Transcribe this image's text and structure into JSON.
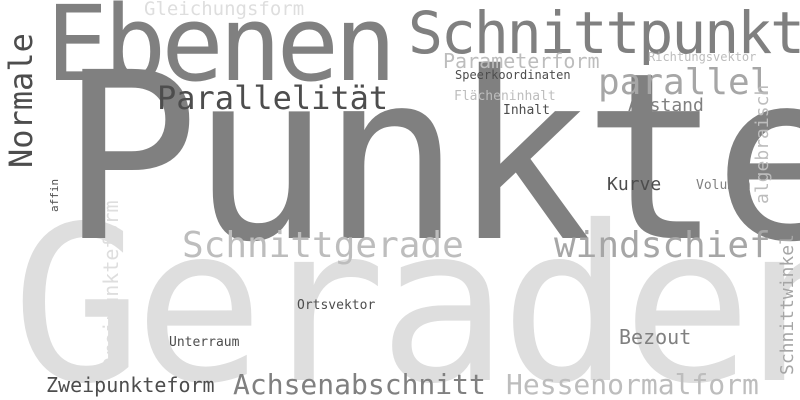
{
  "words": [
    {
      "id": "gerade",
      "text": "Geraden",
      "color": "#dedede"
    },
    {
      "id": "punkte",
      "text": "Punkte",
      "color": "#808080"
    },
    {
      "id": "ebenen",
      "text": "Ebenen",
      "color": "#808080"
    },
    {
      "id": "schnittpunkt",
      "text": "Schnittpunkt",
      "color": "#808080"
    },
    {
      "id": "gleichungsform",
      "text": "Gleichungsform",
      "color": "#dedede"
    },
    {
      "id": "parameterform",
      "text": "Parameterform",
      "color": "#bdbdbd"
    },
    {
      "id": "richtungsvektor",
      "text": "Richtungsvektor",
      "color": "#bdbdbd"
    },
    {
      "id": "speerkoordinaten",
      "text": "Speerkoordinaten",
      "color": "#4d4d4d"
    },
    {
      "id": "parallel",
      "text": "parallel",
      "color": "#a6a6a6"
    },
    {
      "id": "parallelitaet",
      "text": "Parallelität",
      "color": "#4d4d4d"
    },
    {
      "id": "flaecheninhalt",
      "text": "Flächeninhalt",
      "color": "#bdbdbd"
    },
    {
      "id": "abstand",
      "text": "Abstand",
      "color": "#808080"
    },
    {
      "id": "inhalt",
      "text": "Inhalt",
      "color": "#4d4d4d"
    },
    {
      "id": "normale",
      "text": "Normale",
      "color": "#4d4d4d"
    },
    {
      "id": "affin",
      "text": "affin",
      "color": "#4d4d4d"
    },
    {
      "id": "dreipunkteform",
      "text": "Dreipunkteform",
      "color": "#dedede"
    },
    {
      "id": "schnittgerade",
      "text": "Schnittgerade",
      "color": "#bdbdbd"
    },
    {
      "id": "windschief",
      "text": "windschief",
      "color": "#a6a6a6"
    },
    {
      "id": "kurve",
      "text": "Kurve",
      "color": "#4d4d4d"
    },
    {
      "id": "volumen",
      "text": "Volumen",
      "color": "#808080"
    },
    {
      "id": "algebraisch",
      "text": "algebraisch",
      "color": "#bdbdbd"
    },
    {
      "id": "schnittwinkel",
      "text": "Schnittwinkel",
      "color": "#a6a6a6"
    },
    {
      "id": "ortsvektor",
      "text": "Ortsvektor",
      "color": "#4d4d4d"
    },
    {
      "id": "unterraum",
      "text": "Unterraum",
      "color": "#4d4d4d"
    },
    {
      "id": "bezout",
      "text": "Bezout",
      "color": "#808080"
    },
    {
      "id": "zweipunkteform",
      "text": "Zweipunkteform",
      "color": "#4d4d4d"
    },
    {
      "id": "achsenabschnitt",
      "text": "Achsenabschnitt",
      "color": "#808080"
    },
    {
      "id": "hessenormalform",
      "text": "Hessenormalform",
      "color": "#bdbdbd"
    }
  ]
}
